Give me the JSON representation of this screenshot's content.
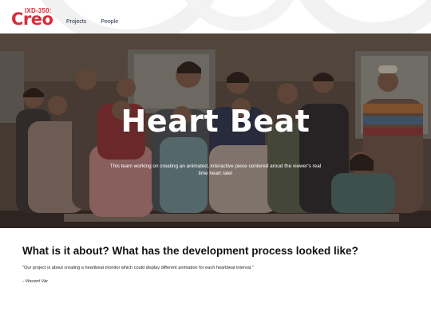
{
  "header": {
    "logo_top": "IXD-350:",
    "logo_main": "Creo",
    "nav": [
      {
        "label": "Projects"
      },
      {
        "label": "People"
      }
    ]
  },
  "hero": {
    "title": "Heart Beat",
    "subtitle": "This team working on creating an animated, interactive piece centered aroud the viewer's real time heart rate!"
  },
  "section": {
    "heading": "What is it about? What has the development process looked like?",
    "quote": "\"Our project is about creating a heartbeat monitor which could display different animation for each heartbeat interval.\"",
    "attribution": "- Vincent Var"
  },
  "colors": {
    "brand_red": "#d62e3c",
    "nav_text": "#1b2a44"
  }
}
